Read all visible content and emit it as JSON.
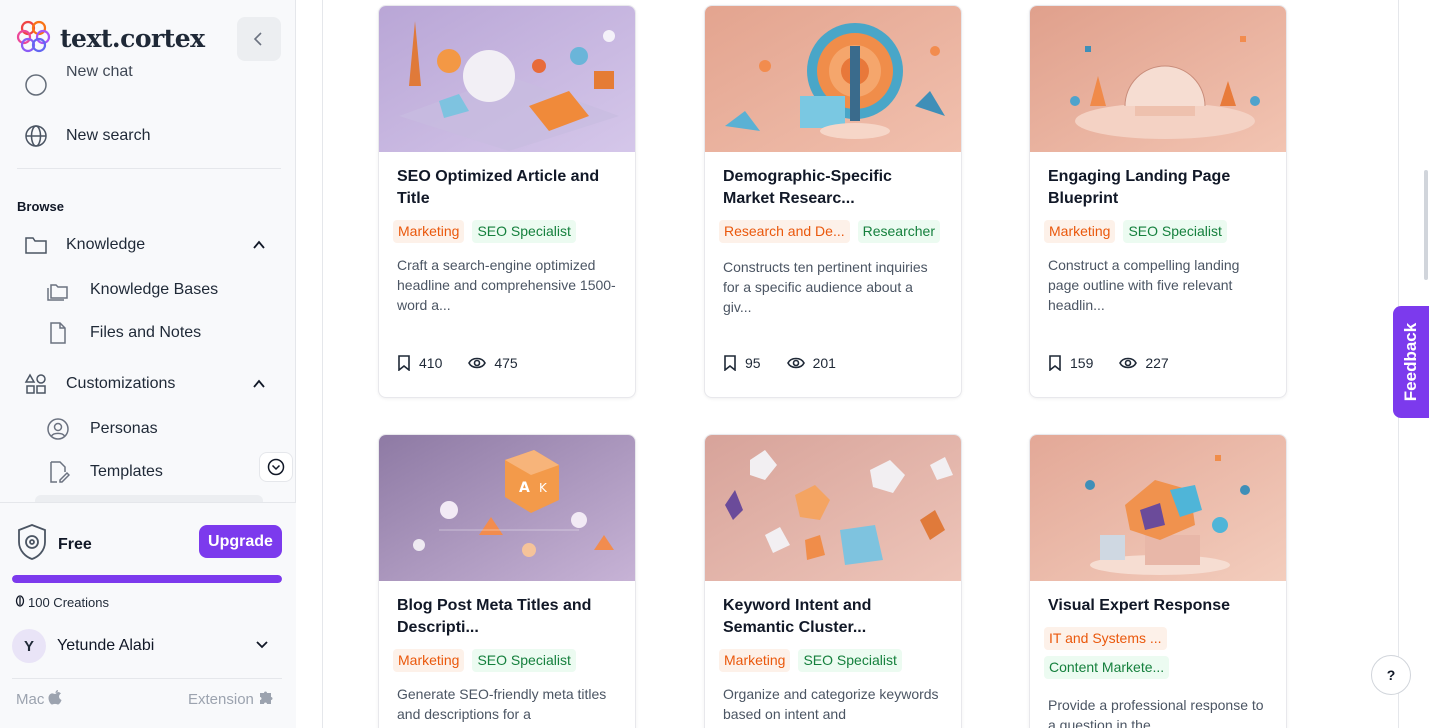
{
  "brand": {
    "name": "text.cortex"
  },
  "sidebar": {
    "partial_item": "New chat",
    "new_search": "New search",
    "browse_label": "Browse",
    "knowledge": "Knowledge",
    "knowledge_bases": "Knowledge Bases",
    "files_notes": "Files and Notes",
    "customizations": "Customizations",
    "personas": "Personas",
    "templates": "Templates"
  },
  "plan": {
    "name": "Free",
    "upgrade_label": "Upgrade",
    "usage_fraction": 1.0,
    "credits": "100 Creations"
  },
  "user": {
    "initial": "Y",
    "name": "Yetunde Alabi"
  },
  "platforms": {
    "mac": "Mac",
    "extension": "Extension"
  },
  "feedback_label": "Feedback",
  "help_label": "?",
  "colors": {
    "accent": "#7c3aed",
    "tag_orange": "#ea580c",
    "tag_green": "#15803d"
  },
  "cards": [
    {
      "title": "SEO Optimized Article and Title",
      "tags": [
        {
          "label": "Marketing",
          "tone": "orange"
        },
        {
          "label": "SEO Specialist",
          "tone": "green"
        }
      ],
      "description": "Craft a search-engine optimized headline and comprehensive 1500-word a...",
      "saves": "410",
      "views": "475"
    },
    {
      "title": "Demographic-Specific Market Researc...",
      "tags": [
        {
          "label": "Research and De...",
          "tone": "orange"
        },
        {
          "label": "Researcher",
          "tone": "green"
        }
      ],
      "description": "Constructs ten pertinent inquiries for a specific audience about a giv...",
      "saves": "95",
      "views": "201"
    },
    {
      "title": "Engaging Landing Page Blueprint",
      "tags": [
        {
          "label": "Marketing",
          "tone": "orange"
        },
        {
          "label": "SEO Specialist",
          "tone": "green"
        }
      ],
      "description": "Construct a compelling landing page outline with five relevant headlin...",
      "saves": "159",
      "views": "227"
    },
    {
      "title": "Blog Post Meta Titles and Descripti...",
      "tags": [
        {
          "label": "Marketing",
          "tone": "orange"
        },
        {
          "label": "SEO Specialist",
          "tone": "green"
        }
      ],
      "description": "Generate SEO-friendly meta titles and descriptions for a",
      "saves": "",
      "views": ""
    },
    {
      "title": "Keyword Intent and Semantic Cluster...",
      "tags": [
        {
          "label": "Marketing",
          "tone": "orange"
        },
        {
          "label": "SEO Specialist",
          "tone": "green"
        }
      ],
      "description": "Organize and categorize keywords based on intent and",
      "saves": "",
      "views": ""
    },
    {
      "title": "Visual Expert Response",
      "tags": [
        {
          "label": "IT and Systems ...",
          "tone": "orange"
        },
        {
          "label": "Content Markete...",
          "tone": "green"
        }
      ],
      "description": "Provide a professional response to a question in the",
      "saves": "",
      "views": ""
    }
  ]
}
